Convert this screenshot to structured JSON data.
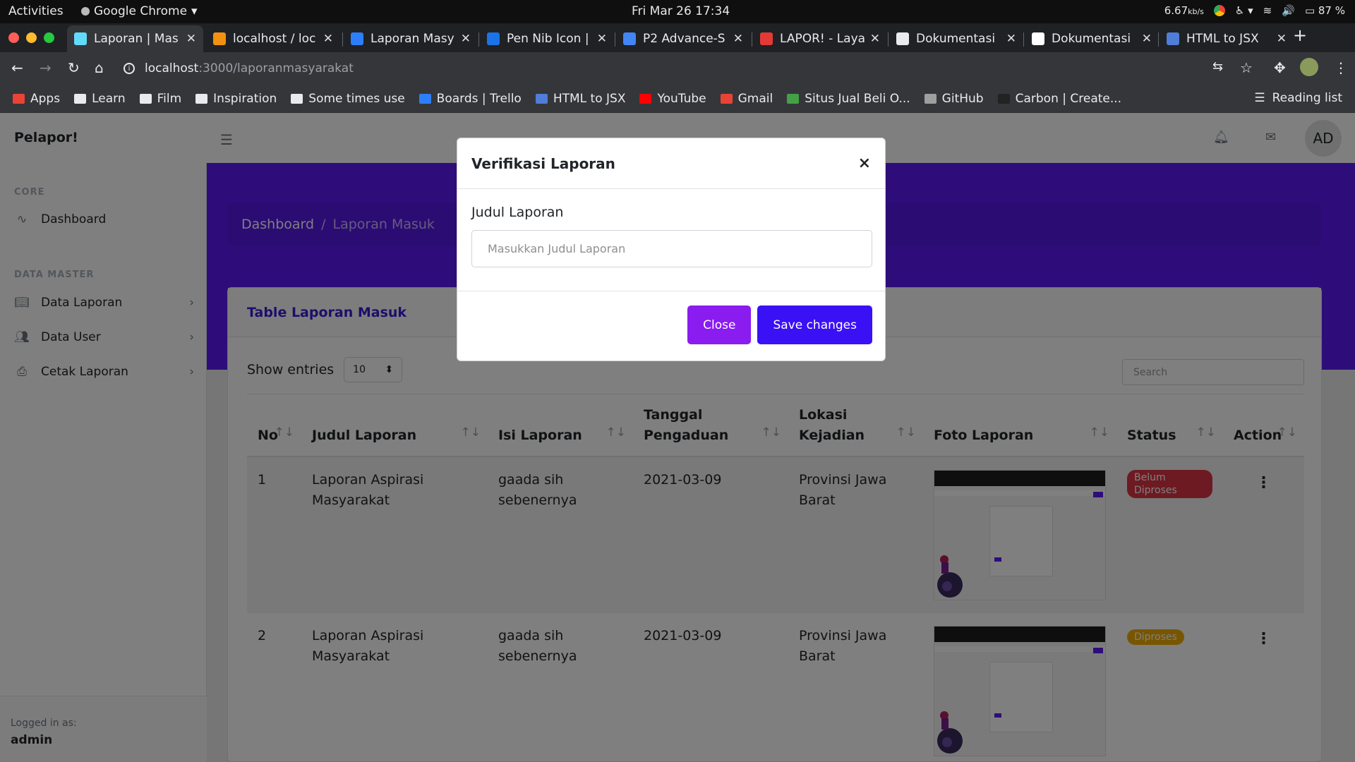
{
  "os": {
    "activities": "Activities",
    "app_name": "Google Chrome",
    "clock": "Fri Mar 26  17:34",
    "net_speed": "6.67",
    "net_unit": "kb/s",
    "battery": "87 %"
  },
  "browser": {
    "tabs": [
      {
        "label": "Laporan | Mas",
        "active": true,
        "fav_color": "#61dafb"
      },
      {
        "label": "localhost / loc",
        "active": false,
        "fav_color": "#f29111"
      },
      {
        "label": "Laporan Masy",
        "active": false,
        "fav_color": "#2d7ff9"
      },
      {
        "label": "Pen Nib Icon |",
        "active": false,
        "fav_color": "#1a73e8"
      },
      {
        "label": "P2 Advance-S",
        "active": false,
        "fav_color": "#4285f4"
      },
      {
        "label": "LAPOR! - Layar",
        "active": false,
        "fav_color": "#e53935"
      },
      {
        "label": "Dokumentasi",
        "active": false,
        "fav_color": "#e8eaed"
      },
      {
        "label": "Dokumentasi",
        "active": false,
        "fav_color": "#ffffff"
      },
      {
        "label": "HTML to JSX",
        "active": false,
        "fav_color": "#4f7dd8"
      }
    ],
    "url_host": "localhost",
    "url_path": ":3000/laporanmasyarakat",
    "bookmarks": [
      {
        "label": "Apps",
        "color": "#ea4335"
      },
      {
        "label": "Learn",
        "color": "#e8eaed"
      },
      {
        "label": "Film",
        "color": "#e8eaed"
      },
      {
        "label": "Inspiration",
        "color": "#e8eaed"
      },
      {
        "label": "Some times use",
        "color": "#e8eaed"
      },
      {
        "label": "Boards | Trello",
        "color": "#2d7ff9"
      },
      {
        "label": "HTML to JSX",
        "color": "#4f7dd8"
      },
      {
        "label": "YouTube",
        "color": "#ff0000"
      },
      {
        "label": "Gmail",
        "color": "#ea4335"
      },
      {
        "label": "Situs Jual Beli O...",
        "color": "#43a047"
      },
      {
        "label": "GitHub",
        "color": "#9e9e9e"
      },
      {
        "label": "Carbon | Create...",
        "color": "#222222"
      }
    ],
    "reading_list": "Reading list"
  },
  "app": {
    "brand": "Pelapor!",
    "avatar": "AD",
    "sidebar": {
      "core_heading": "CORE",
      "dashboard": "Dashboard",
      "master_heading": "DATA MASTER",
      "items": [
        "Data Laporan",
        "Data User",
        "Cetak Laporan"
      ],
      "logged_label": "Logged in as:",
      "user": "admin"
    },
    "breadcrumb": {
      "home": "Dashboard",
      "separator": "/",
      "current": "Laporan Masuk"
    },
    "card_title": "Table Laporan Masuk",
    "show_entries": "Show entries",
    "entries_value": "10",
    "search_placeholder": "Search",
    "columns": [
      "No",
      "Judul Laporan",
      "Isi Laporan",
      "Tanggal Pengaduan",
      "Lokasi Kejadian",
      "Foto Laporan",
      "Status",
      "Action"
    ],
    "rows": [
      {
        "no": "1",
        "judul": "Laporan Aspirasi Masyarakat",
        "isi": "gaada sih sebenernya",
        "tanggal": "2021-03-09",
        "lokasi": "Provinsi Jawa Barat",
        "status": "Belum Diproses",
        "status_color": "#dc3545"
      },
      {
        "no": "2",
        "judul": "Laporan Aspirasi Masyarakat",
        "isi": "gaada sih sebenernya",
        "tanggal": "2021-03-09",
        "lokasi": "Provinsi Jawa Barat",
        "status": "Diproses",
        "status_color": "#f0ad00"
      }
    ],
    "accent": "#5d1af5"
  },
  "modal": {
    "title": "Verifikasi Laporan",
    "close_glyph": "×",
    "label": "Judul Laporan",
    "placeholder": "Masukkan Judul Laporan",
    "close_button": "Close",
    "close_button_color": "#8a1cf0",
    "save_button": "Save changes",
    "save_button_color": "#3a10f5"
  }
}
